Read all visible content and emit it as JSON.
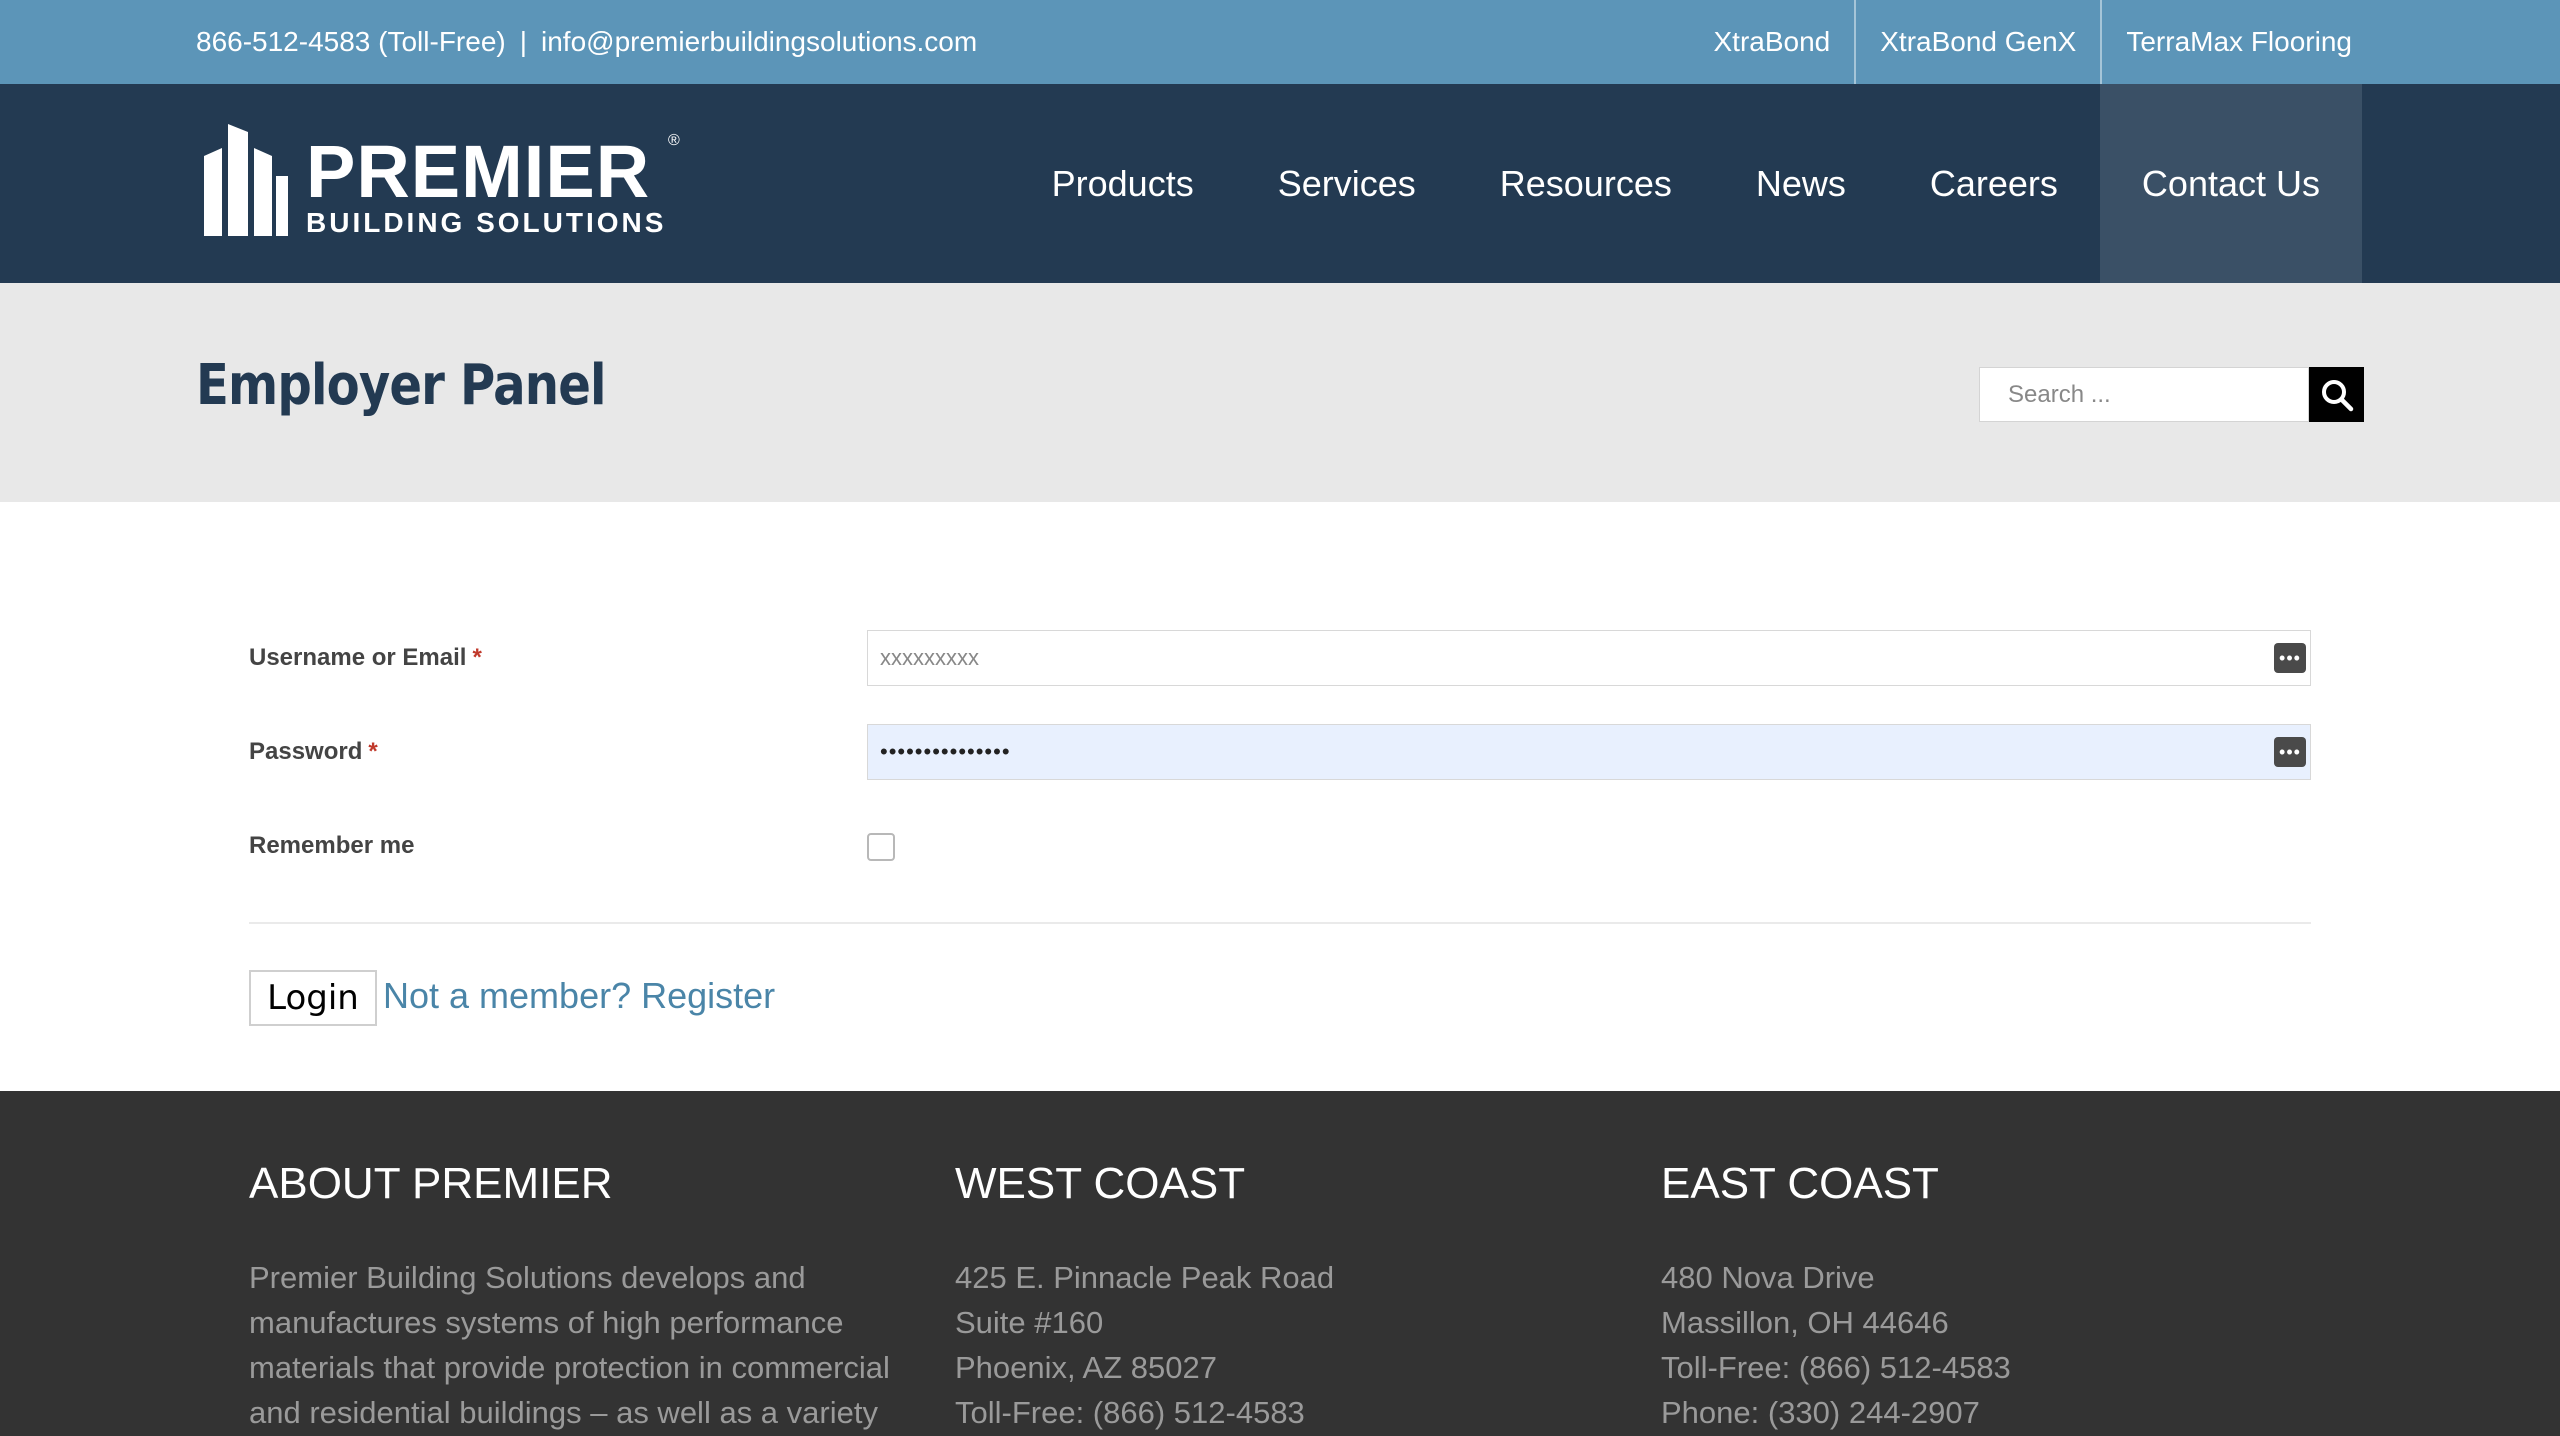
{
  "topbar": {
    "phone": "866-512-4583 (Toll-Free)",
    "separator": "|",
    "email": "info@premierbuildingsolutions.com",
    "links": [
      "XtraBond",
      "XtraBond GenX",
      "TerraMax Flooring"
    ]
  },
  "logo": {
    "word": "PREMIER",
    "sub": "BUILDING SOLUTIONS",
    "reg": "®"
  },
  "nav": {
    "items": [
      "Products",
      "Services",
      "Resources",
      "News",
      "Careers",
      "Contact Us"
    ],
    "active": "Contact Us"
  },
  "page": {
    "title": "Employer Panel"
  },
  "search": {
    "placeholder": "Search ..."
  },
  "form": {
    "username_label": "Username or Email",
    "username_value": "xxxxxxxxx",
    "password_label": "Password",
    "password_value": "•••••••••••••••",
    "remember_label": "Remember me",
    "required_mark": "*",
    "login_label": "Login",
    "register_label": "Not a member? Register",
    "kbd_glyph": "•••"
  },
  "footer": {
    "about": {
      "heading": "ABOUT PREMIER",
      "lines": [
        "Premier Building Solutions develops and",
        "manufactures systems of high performance",
        "materials that provide protection in commercial",
        "and residential buildings – as well as a variety of"
      ]
    },
    "west": {
      "heading": "WEST COAST",
      "lines": [
        "425 E. Pinnacle Peak Road",
        "Suite #160",
        "Phoenix, AZ 85027",
        "Toll-Free: (866) 512-4583"
      ]
    },
    "east": {
      "heading": "EAST COAST",
      "lines": [
        "480 Nova Drive",
        "Massillon, OH 44646",
        "Toll-Free: (866) 512-4583",
        "Phone: (330) 244-2907"
      ]
    }
  },
  "colors": {
    "topbar": "#5c95b8",
    "navbar": "#233a52",
    "title": "#233a52",
    "link": "#4a85a8",
    "footer": "#333333"
  }
}
